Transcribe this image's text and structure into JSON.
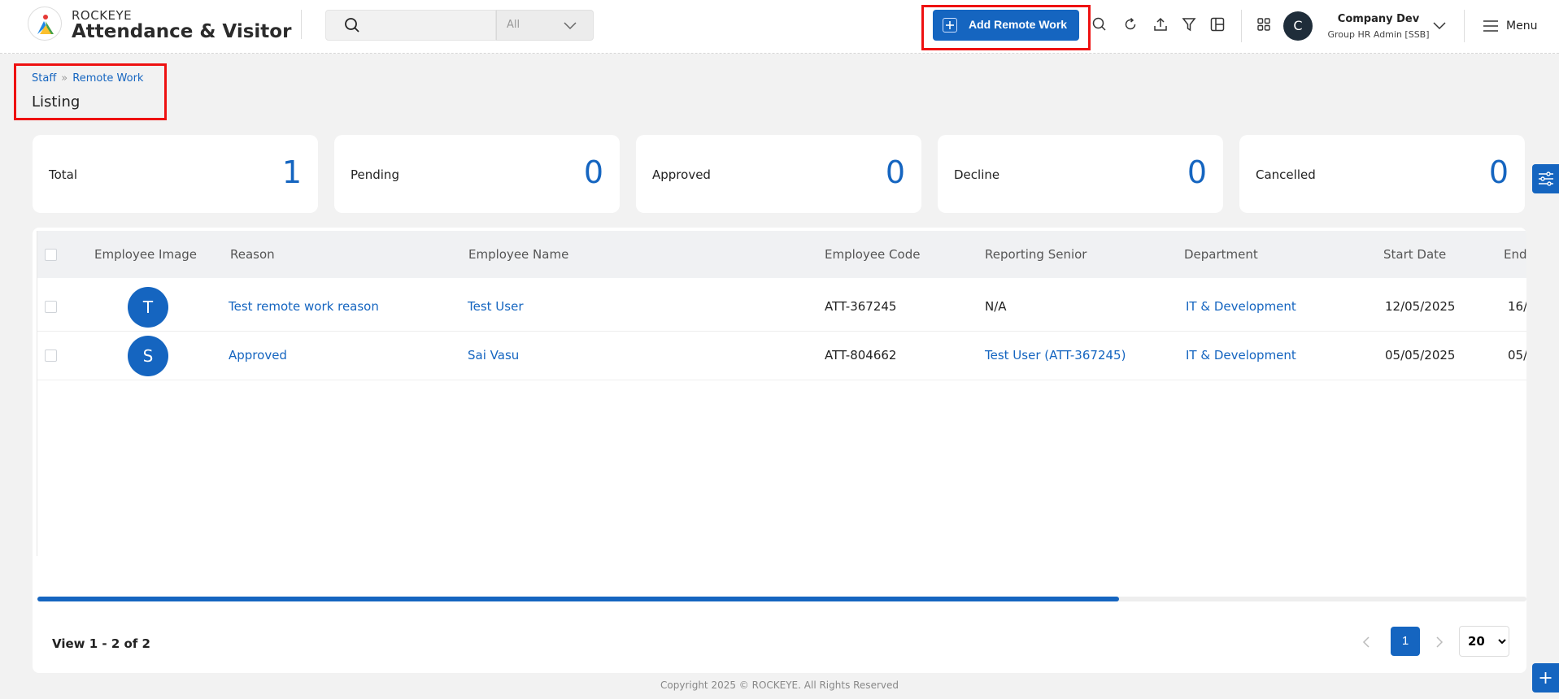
{
  "header": {
    "brand_top": "ROCKEYE",
    "brand_main": "Attendance & Visitor",
    "search_placeholder": "",
    "scope_value": "All",
    "add_button_label": "Add Remote Work",
    "user": {
      "initial": "C",
      "name": "Company Dev",
      "role": "Group HR Admin [SSB]"
    },
    "menu_label": "Menu"
  },
  "breadcrumb": {
    "items": [
      "Staff",
      "Remote Work"
    ],
    "title": "Listing"
  },
  "stats": [
    {
      "label": "Total",
      "value": "1"
    },
    {
      "label": "Pending",
      "value": "0"
    },
    {
      "label": "Approved",
      "value": "0"
    },
    {
      "label": "Decline",
      "value": "0"
    },
    {
      "label": "Cancelled",
      "value": "0"
    }
  ],
  "table": {
    "columns": [
      "Employee Image",
      "Reason",
      "Employee Name",
      "Employee Code",
      "Reporting Senior",
      "Department",
      "Start Date",
      "End"
    ],
    "rows": [
      {
        "initial": "T",
        "reason": "Test remote work reason",
        "name": "Test User",
        "code": "ATT-367245",
        "senior": "N/A",
        "department": "IT & Development",
        "start": "12/05/2025",
        "end": "16/"
      },
      {
        "initial": "S",
        "reason": "Approved",
        "name": "Sai Vasu",
        "code": "ATT-804662",
        "senior": "Test User (ATT-367245)",
        "department": "IT & Development",
        "start": "05/05/2025",
        "end": "05/"
      }
    ]
  },
  "pagination": {
    "view_text": "View 1 - 2 of 2",
    "current_page": "1",
    "page_size": "20"
  },
  "footer": "Copyright 2025 © ROCKEYE. All Rights Reserved",
  "colors": {
    "accent": "#1565c0",
    "highlight": "#e11111"
  }
}
